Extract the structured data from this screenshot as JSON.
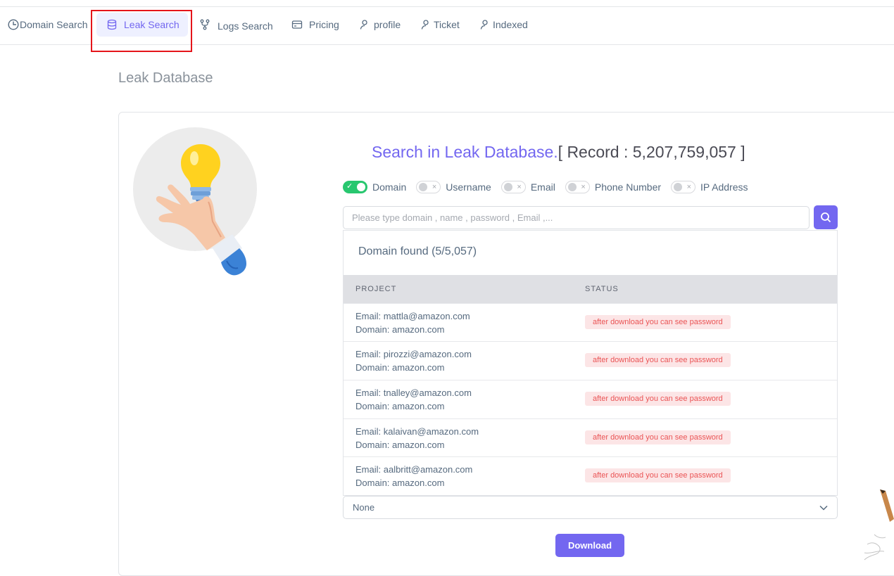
{
  "nav": {
    "items": [
      {
        "label": "Domain Search",
        "icon": "clock-icon"
      },
      {
        "label": "Leak Search",
        "icon": "database-icon",
        "active": true
      },
      {
        "label": "Logs Search",
        "icon": "git-fork-icon"
      },
      {
        "label": "Pricing",
        "icon": "credit-card-icon"
      },
      {
        "label": "profile",
        "icon": "user-icon"
      },
      {
        "label": "Ticket",
        "icon": "user-icon"
      },
      {
        "label": "Indexed",
        "icon": "user-icon"
      }
    ]
  },
  "page": {
    "title": "Leak Database"
  },
  "search": {
    "heading": "Search in Leak Database.",
    "record": "[ Record : 5,207,759,057 ]",
    "placeholder": "Please type domain , name , password , Email ,...",
    "filters": [
      {
        "label": "Domain",
        "on": true
      },
      {
        "label": "Username",
        "on": false
      },
      {
        "label": "Email",
        "on": false
      },
      {
        "label": "Phone Number",
        "on": false
      },
      {
        "label": "IP Address",
        "on": false
      }
    ]
  },
  "results": {
    "title": "Domain found (5/5,057)",
    "columns": [
      "PROJECT",
      "STATUS"
    ],
    "rows": [
      {
        "email": "Email: mattla@amazon.com",
        "domain": "Domain: amazon.com",
        "status": "after download you can see password"
      },
      {
        "email": "Email: pirozzi@amazon.com",
        "domain": "Domain: amazon.com",
        "status": "after download you can see password"
      },
      {
        "email": "Email: tnalley@amazon.com",
        "domain": "Domain: amazon.com",
        "status": "after download you can see password"
      },
      {
        "email": "Email: kalaivan@amazon.com",
        "domain": "Domain: amazon.com",
        "status": "after download you can see password"
      },
      {
        "email": "Email: aalbritt@amazon.com",
        "domain": "Domain: amazon.com",
        "status": "after download you can see password"
      }
    ]
  },
  "select": {
    "value": "None"
  },
  "download": {
    "label": "Download"
  },
  "colors": {
    "primary": "#7367f0",
    "success": "#28c76f",
    "danger": "#ea5455",
    "highlight": "#e5141a"
  }
}
